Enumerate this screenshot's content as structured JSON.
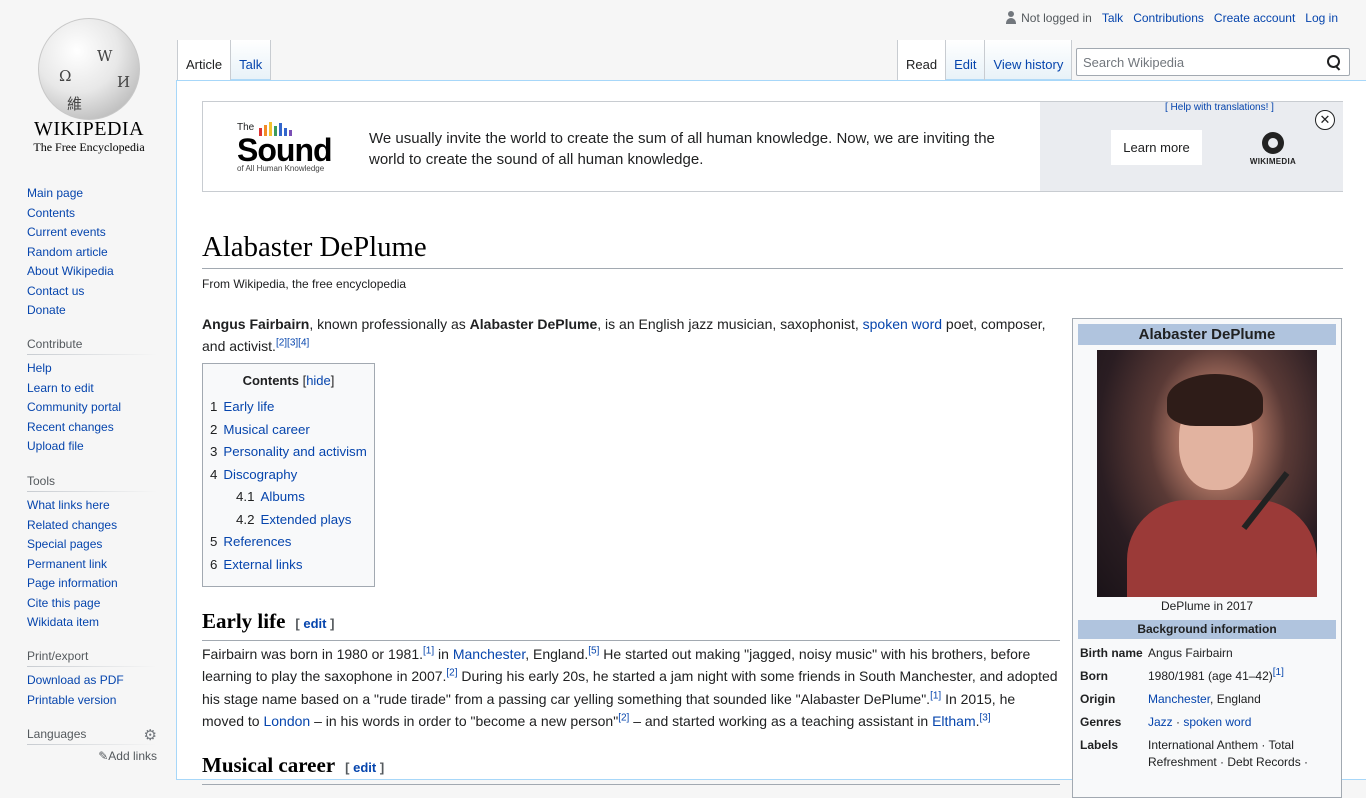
{
  "logo": {
    "wordmark": "WIKIPEDIA",
    "tagline": "The Free Encyclopedia",
    "globe_glyphs": [
      "W",
      "Ω",
      "И",
      "維"
    ]
  },
  "nav": {
    "main": [
      "Main page",
      "Contents",
      "Current events",
      "Random article",
      "About Wikipedia",
      "Contact us",
      "Donate"
    ],
    "contribute_heading": "Contribute",
    "contribute": [
      "Help",
      "Learn to edit",
      "Community portal",
      "Recent changes",
      "Upload file"
    ],
    "tools_heading": "Tools",
    "tools": [
      "What links here",
      "Related changes",
      "Special pages",
      "Permanent link",
      "Page information",
      "Cite this page",
      "Wikidata item"
    ],
    "print_heading": "Print/export",
    "print": [
      "Download as PDF",
      "Printable version"
    ],
    "languages_heading": "Languages",
    "add_links": "Add links"
  },
  "personal": {
    "not_logged_in": "Not logged in",
    "talk": "Talk",
    "contributions": "Contributions",
    "create_account": "Create account",
    "login": "Log in"
  },
  "tabs": {
    "left": [
      "Article",
      "Talk"
    ],
    "right": [
      "Read",
      "Edit",
      "View history"
    ]
  },
  "search": {
    "placeholder": "Search Wikipedia"
  },
  "banner": {
    "logo_the": "The",
    "logo_word": "Sound",
    "logo_sub": "of All Human Knowledge",
    "bar_colors": [
      "#d33",
      "#f28c28",
      "#f2c12e",
      "#3d9c5c",
      "#36c",
      "#36c",
      "#7a4fb5"
    ],
    "bar_heights": [
      0.55,
      0.8,
      1.0,
      0.7,
      0.9,
      0.6,
      0.45
    ],
    "text": "We usually invite the world to create the sum of all human knowledge. Now, we are inviting the world to create the sound of all human knowledge.",
    "help_link": "[ Help with translations! ]",
    "learn_more": "Learn more",
    "wikimedia": "WIKIMEDIA",
    "close": "✕"
  },
  "article": {
    "title": "Alabaster DePlume",
    "site_sub": "From Wikipedia, the free encyclopedia",
    "lead": {
      "name": "Angus Fairbairn",
      "t1": ", known professionally as ",
      "stage": "Alabaster DePlume",
      "t2": ", is an English jazz musician, saxophonist, ",
      "link1": "spoken word",
      "t3": " poet, composer, and activist.",
      "refs": "[2][3][4]"
    },
    "toc": {
      "title": "Contents",
      "hide": "hide",
      "items": [
        {
          "num": "1",
          "label": "Early life",
          "level": 1
        },
        {
          "num": "2",
          "label": "Musical career",
          "level": 1
        },
        {
          "num": "3",
          "label": "Personality and activism",
          "level": 1
        },
        {
          "num": "4",
          "label": "Discography",
          "level": 1
        },
        {
          "num": "4.1",
          "label": "Albums",
          "level": 2
        },
        {
          "num": "4.2",
          "label": "Extended plays",
          "level": 2
        },
        {
          "num": "5",
          "label": "References",
          "level": 1
        },
        {
          "num": "6",
          "label": "External links",
          "level": 1
        }
      ]
    },
    "section1": {
      "heading": "Early life",
      "edit": "edit"
    },
    "para2": {
      "a": "Fairbairn was born in 1980 or 1981.",
      "r1": "[1]",
      "b": " in ",
      "manchester": "Manchester",
      "c": ", England.",
      "r2": "[5]",
      "d": " He started out making \"jagged, noisy music\" with his brothers, before learning to play the saxophone in 2007.",
      "r3": "[2]",
      "e": " During his early 20s, he started a jam night with some friends in South Manchester, and adopted his stage name based on a \"rude tirade\" from a passing car yelling something that sounded like \"Alabaster DePlume\".",
      "r4": "[1]",
      "f": " In 2015, he moved to ",
      "london": "London",
      "g": " – in his words in order to \"become a new person\"",
      "r5": "[2]",
      "h": " – and started working as a teaching assistant in ",
      "eltham": "Eltham",
      "i": ".",
      "r6": "[3]"
    },
    "section2": {
      "heading": "Musical career",
      "edit": "edit"
    }
  },
  "infobox": {
    "title": "Alabaster DePlume",
    "caption": "DePlume in 2017",
    "section": "Background information",
    "birth_name_k": "Birth name",
    "birth_name_v": "Angus Fairbairn",
    "born_k": "Born",
    "born_v": "1980/1981 (age 41–42)",
    "born_ref": "[1]",
    "origin_k": "Origin",
    "origin_link": "Manchester",
    "origin_rest": ", England",
    "genres_k": "Genres",
    "genre1": "Jazz",
    "genre_sep": " · ",
    "genre2": "spoken word",
    "labels_k": "Labels",
    "labels_v": "International Anthem · Total Refreshment · Debt Records ·"
  }
}
